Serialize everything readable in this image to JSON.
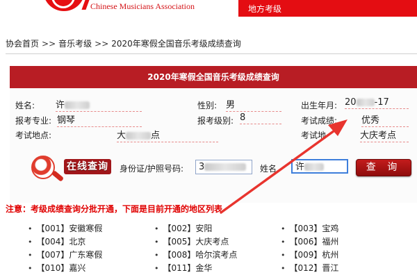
{
  "header": {
    "logo_en": "Chinese Musicians Association",
    "nav_label": "地方考级",
    "accent_color": "#e40d12"
  },
  "breadcrumb": {
    "items": [
      "协会首页",
      "音乐考级",
      "2020年寒假全国音乐考级成绩查询"
    ],
    "separator": ">>"
  },
  "result_panel": {
    "title": "2020年寒假全国音乐考级成绩查询",
    "title_bg": "#b81d24",
    "name_label": "姓名:",
    "name_value": "许",
    "gender_label": "性别:",
    "gender_value": "男",
    "birth_label": "出生年月:",
    "birth_value_start": "20",
    "birth_value_end": "-17",
    "major_label": "报考专业:",
    "major_value": "钢琴",
    "level_label": "报考级别:",
    "level_value": "8",
    "score_label": "考试成绩:",
    "score_value": "优秀",
    "site_label": "考试地点:",
    "site_value_start": "大",
    "site_value_end": "点",
    "site_label_right": "考试地",
    "site_value_right": "大庆考点"
  },
  "query_form": {
    "online_button_label": "在线查询",
    "id_label": "身份证/护照号码:",
    "id_value": "3",
    "name_label": "姓名",
    "name_value": "许",
    "submit_label": "查 询"
  },
  "notice": {
    "text": "注意：考级成绩查询分批开通，下面是目前开通的地区列表",
    "color": "#e00000"
  },
  "regions": [
    [
      "【001】安徽寒假",
      "【002】安阳",
      "【003】宝鸡"
    ],
    [
      "【004】北京",
      "【005】大庆考点",
      "【006】福州"
    ],
    [
      "【007】广东寒假",
      "【008】哈尔滨考点",
      "【009】杭州"
    ],
    [
      "【010】嘉兴",
      "【011】金华",
      "【012】晋江"
    ]
  ],
  "annotation": {
    "arrow_color": "#e8342e"
  }
}
